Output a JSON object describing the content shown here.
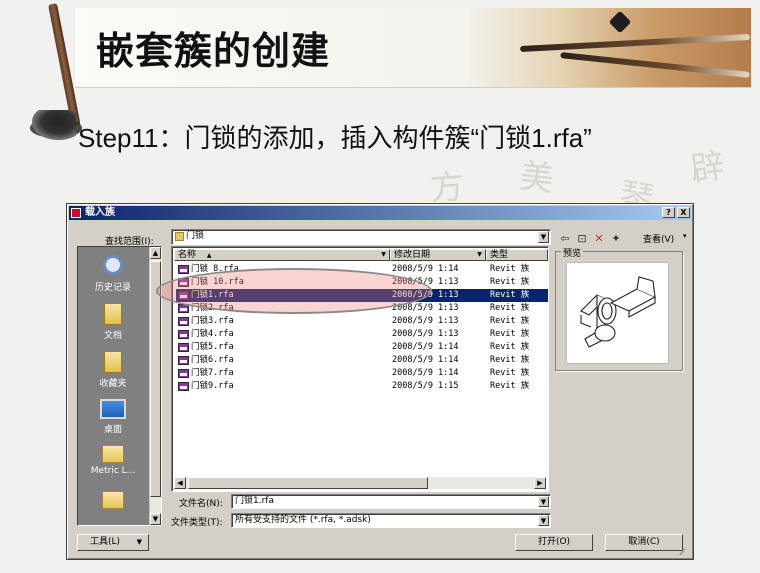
{
  "slide": {
    "title": "嵌套簇的创建",
    "step": "Step11：门锁的添加，插入构件簇“门锁1.rfa”"
  },
  "dialog": {
    "title": "载入族",
    "help_btn": "?",
    "close_btn": "X",
    "lookin_label": "查找范围(I):",
    "lookin_value": "门锁",
    "views_label": "查看(V)",
    "places": [
      {
        "label": "历史记录",
        "icon": "history-icon"
      },
      {
        "label": "文档",
        "icon": "documents-icon"
      },
      {
        "label": "收藏夹",
        "icon": "favorites-icon"
      },
      {
        "label": "桌面",
        "icon": "desktop-icon"
      },
      {
        "label": "Metric L...",
        "icon": "folder-icon"
      }
    ],
    "columns": {
      "name": "名称",
      "date": "修改日期",
      "type": "类型"
    },
    "files": [
      {
        "name": "门锁 8.rfa",
        "date": "2008/5/9 1:14",
        "type": "Revit 族"
      },
      {
        "name": "门锁 10.rfa",
        "date": "2008/5/9 1:13",
        "type": "Revit 族"
      },
      {
        "name": "门锁1.rfa",
        "date": "2008/5/9 1:13",
        "type": "Revit 族"
      },
      {
        "name": "门锁2.rfa",
        "date": "2008/5/9 1:13",
        "type": "Revit 族"
      },
      {
        "name": "门锁3.rfa",
        "date": "2008/5/9 1:13",
        "type": "Revit 族"
      },
      {
        "name": "门锁4.rfa",
        "date": "2008/5/9 1:13",
        "type": "Revit 族"
      },
      {
        "name": "门锁5.rfa",
        "date": "2008/5/9 1:14",
        "type": "Revit 族"
      },
      {
        "name": "门锁6.rfa",
        "date": "2008/5/9 1:14",
        "type": "Revit 族"
      },
      {
        "name": "门锁7.rfa",
        "date": "2008/5/9 1:14",
        "type": "Revit 族"
      },
      {
        "name": "门锁9.rfa",
        "date": "2008/5/9 1:15",
        "type": "Revit 族"
      }
    ],
    "selected_index": 2,
    "preview_label": "预览",
    "filename_label": "文件名(N):",
    "filename_value": "门锁1.rfa",
    "filetype_label": "文件类型(T):",
    "filetype_value": "所有受支持的文件 (*.rfa, *.adsk)",
    "tools_btn": "工具(L)",
    "open_btn": "打开(O)",
    "cancel_btn": "取消(C)"
  },
  "colors": {
    "selection": "#0a246a",
    "titlebar_start": "#0a246a",
    "titlebar_end": "#a6caf0",
    "dialog_face": "#d4d0c8",
    "highlight_oval": "#f07878"
  }
}
